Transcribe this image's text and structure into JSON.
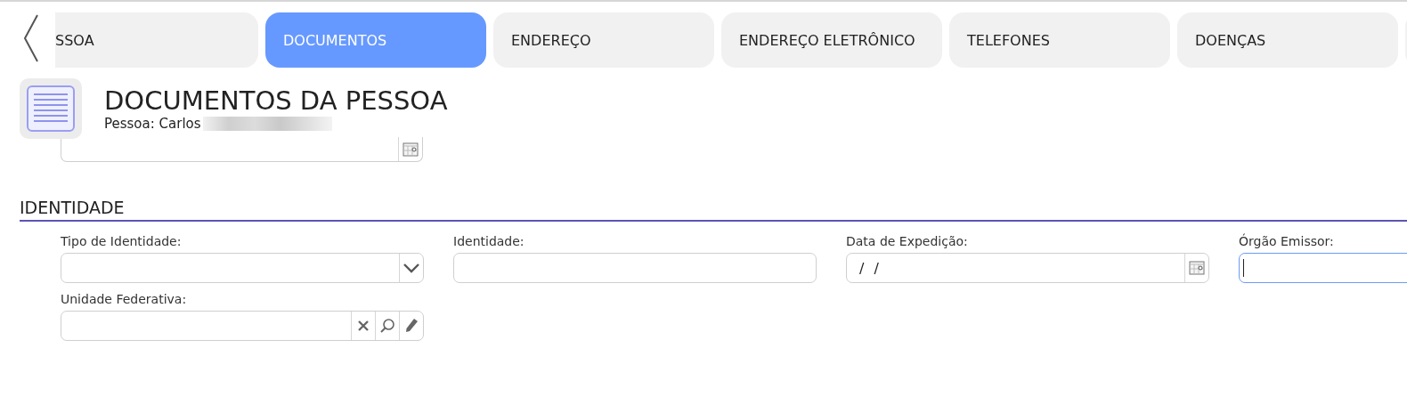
{
  "tabs": [
    {
      "label": "SSOA",
      "selected": false
    },
    {
      "label": "DOCUMENTOS",
      "selected": true
    },
    {
      "label": "ENDEREÇO",
      "selected": false
    },
    {
      "label": "ENDEREÇO ELETRÔNICO",
      "selected": false
    },
    {
      "label": "TELEFONES",
      "selected": false
    },
    {
      "label": "DOENÇAS",
      "selected": false
    }
  ],
  "header": {
    "title": "DOCUMENTOS DA PESSOA",
    "subtitle": "Pessoa: Carlos"
  },
  "top_field": {
    "kind": "date",
    "focused": false
  },
  "section": {
    "title": "IDENTIDADE"
  },
  "fields": [
    {
      "label": "Tipo de Identidade:",
      "kind": "select",
      "focused": false
    },
    {
      "label": "Identidade:",
      "kind": "text",
      "focused": false
    },
    {
      "label": "Data de Expedição:",
      "kind": "date",
      "value": "/ /",
      "focused": false
    },
    {
      "label": "Órgão Emissor:",
      "kind": "text",
      "focused": true
    },
    {
      "label": "Unidade Federativa:",
      "kind": "lookup",
      "focused": false
    }
  ]
}
